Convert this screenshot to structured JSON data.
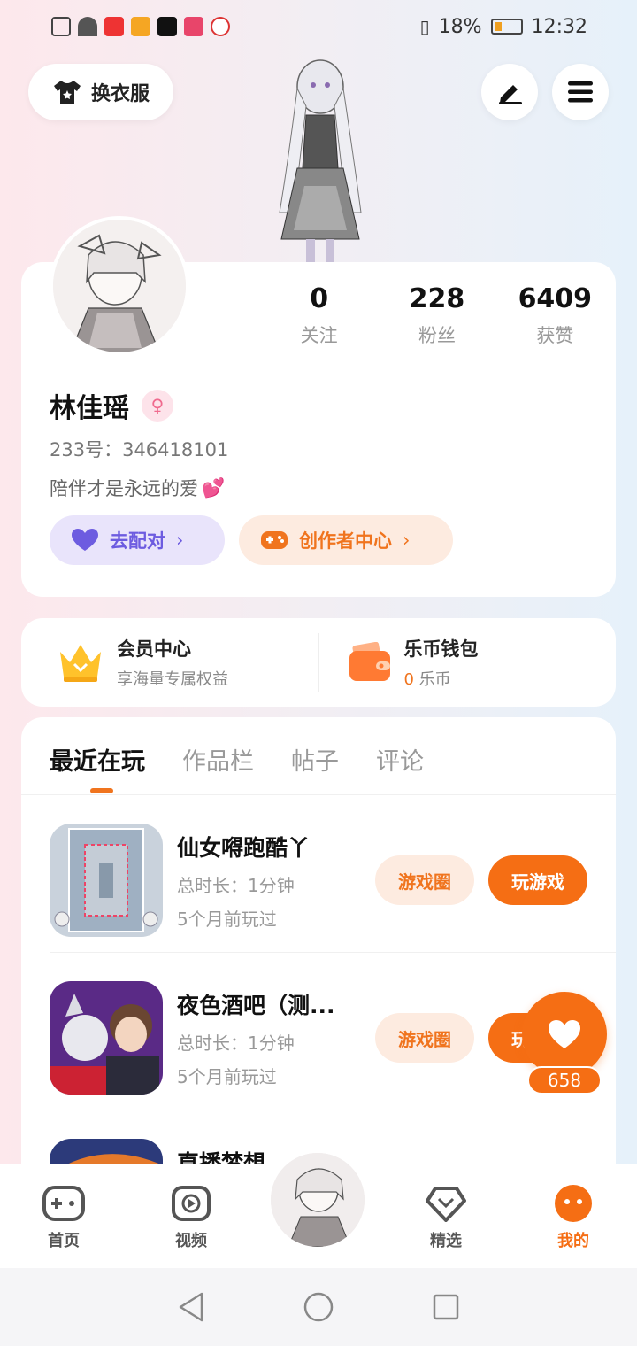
{
  "status_bar": {
    "battery": "18%",
    "time": "12:32"
  },
  "header": {
    "dress_button_label": "换衣服"
  },
  "profile": {
    "stats": [
      {
        "value": "0",
        "label": "关注"
      },
      {
        "value": "228",
        "label": "粉丝"
      },
      {
        "value": "6409",
        "label": "获赞"
      }
    ],
    "name": "林佳瑶",
    "uid": "233号：346418101",
    "bio": "陪伴才是永远的爱",
    "pair_button": "去配对",
    "creator_button": "创作者中心"
  },
  "vip": {
    "member_title": "会员中心",
    "member_sub": "享海量专属权益",
    "wallet_title": "乐币钱包",
    "wallet_coins": "0",
    "wallet_unit": "乐币"
  },
  "tabs": [
    "最近在玩",
    "作品栏",
    "帖子",
    "评论"
  ],
  "games": [
    {
      "name": "仙女嘚跑酷丫",
      "duration": "总时长：1分钟",
      "last_played": "5个月前玩过",
      "circle_label": "游戏圈",
      "play_label": "玩游戏"
    },
    {
      "name": "夜色酒吧（测...",
      "duration": "总时长：1分钟",
      "last_played": "5个月前玩过",
      "circle_label": "游戏圈",
      "play_label": "玩游戏"
    },
    {
      "name": "直播梦想",
      "duration": "",
      "last_played": "",
      "circle_label": "",
      "play_label": ""
    }
  ],
  "like_count": "658",
  "bottom_nav": [
    {
      "label": "首页"
    },
    {
      "label": "视频"
    },
    {
      "label": "精选"
    },
    {
      "label": "我的"
    }
  ],
  "colors": {
    "accent": "#f56e14",
    "purple": "#6d5ce0"
  }
}
